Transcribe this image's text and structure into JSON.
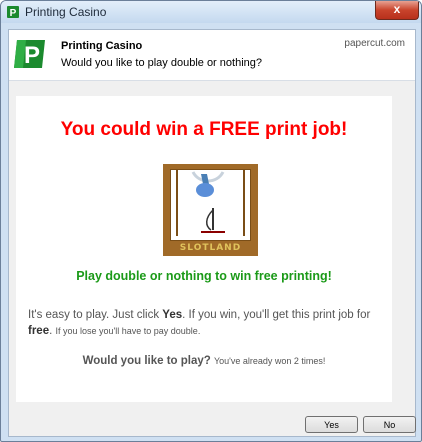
{
  "window": {
    "title": "Printing Casino",
    "close_glyph": "x"
  },
  "header": {
    "title": "Printing Casino",
    "subtitle": "Would you like to play double or nothing?",
    "brand": "papercut.com",
    "logo_icon": "papercut-logo-icon"
  },
  "content": {
    "headline": "You could win a FREE print job!",
    "slot_image": {
      "label": "SLOTLAND",
      "icon": "slot-machine-reel-icon"
    },
    "subheadline": "Play double or nothing to win free printing!",
    "paragraph": {
      "p1": "It's easy to play. Just click ",
      "p1_bold": "Yes",
      "p2": ". If you win, you'll get this print job for ",
      "p2_bold": "free",
      "p3": ". ",
      "p3_small": "If you lose you'll have to pay double."
    },
    "question": "Would you like to play?",
    "question_note": "You've already won 2 times!"
  },
  "buttons": {
    "yes": "Yes",
    "no": "No"
  },
  "colors": {
    "headline": "#ff0000",
    "subheadline": "#1b9a18",
    "brand_green": "#1b8a2e"
  }
}
